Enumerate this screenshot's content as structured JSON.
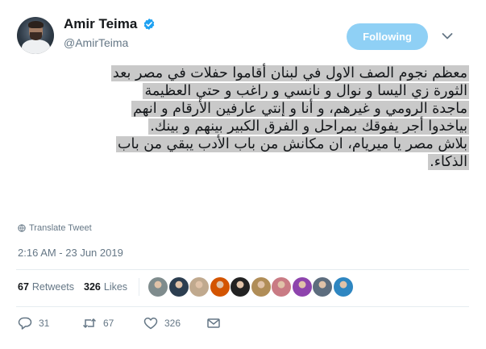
{
  "author": {
    "name": "Amir Teima",
    "handle": "@AmirTeima",
    "verified": true
  },
  "follow_button": {
    "label": "Following"
  },
  "tweet": {
    "lines": [
      "معظم نجوم الصف الاول في لبنان أقاموا حفلات في مصر بعد",
      "الثورة زي اليسا و نوال و نانسي و راغب و حتي العظيمة",
      "ماجدة الرومي و غيرهم، و أنا و إنتي عارفين الأرقام و انهم",
      "بياخدوا أجر يفوقك بمراحل و الفرق الكبير بينهم و بينك.",
      "بلاش مصر يا ميريام، ان مكانش من باب الأدب يبقي من باب",
      "الذكاء."
    ]
  },
  "translate_label": "Translate Tweet",
  "timestamp": "2:16 AM - 23 Jun 2019",
  "stats": {
    "retweets_count": "67",
    "retweets_label": "Retweets",
    "likes_count": "326",
    "likes_label": "Likes"
  },
  "liker_avatar_colors": [
    "#7f8c8d",
    "#2c3e50",
    "#c0a98e",
    "#d35400",
    "#222222",
    "#b08d57",
    "#c97b84",
    "#8e44ad",
    "#5d6d7e",
    "#2e86c1"
  ],
  "actions": {
    "replies": "31",
    "retweets": "67",
    "likes": "326"
  },
  "colors": {
    "follow_button": "#8fd0f5",
    "verified_badge": "#1da1f2",
    "secondary_text": "#657786",
    "highlight": "#c9c9c9"
  }
}
